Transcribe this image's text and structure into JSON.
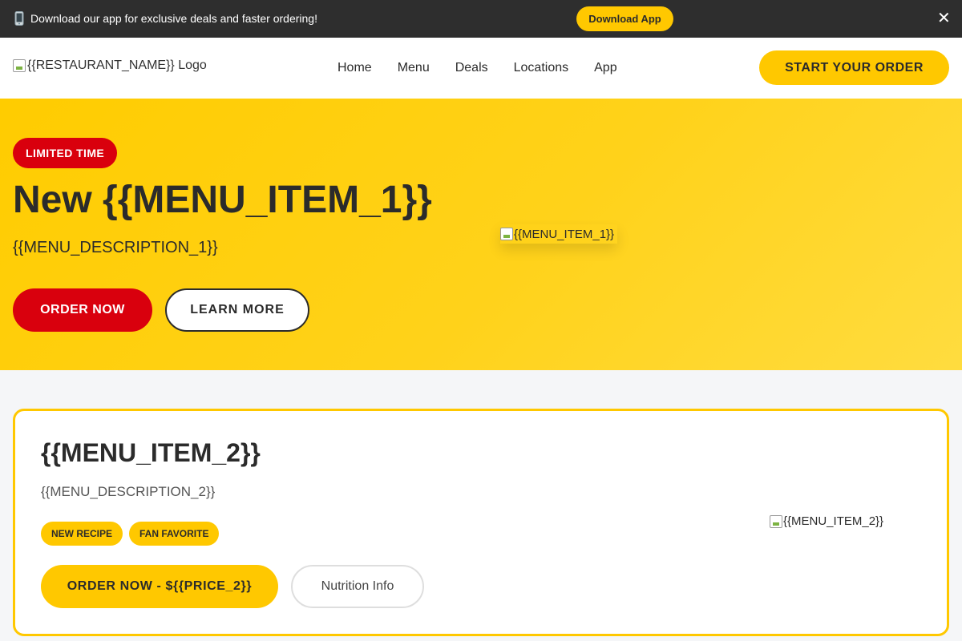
{
  "announcement": {
    "message": "Download our app for exclusive deals and faster ordering!",
    "icon": "mobile-phone-icon",
    "download_label": "Download App",
    "close_glyph": "✕"
  },
  "header": {
    "logo_alt": "{{RESTAURANT_NAME}} Logo",
    "nav": [
      "Home",
      "Menu",
      "Deals",
      "Locations",
      "App"
    ],
    "cta_label": "START YOUR ORDER"
  },
  "hero": {
    "badge": "LIMITED TIME",
    "title": "New {{MENU_ITEM_1}}",
    "description": "{{MENU_DESCRIPTION_1}}",
    "order_label": "ORDER NOW",
    "learn_label": "LEARN MORE",
    "image_alt": "{{MENU_ITEM_1}}"
  },
  "featured": {
    "title": "{{MENU_ITEM_2}}",
    "description": "{{MENU_DESCRIPTION_2}}",
    "tags": [
      "NEW RECIPE",
      "FAN FAVORITE"
    ],
    "order_label": "ORDER NOW - ${{PRICE_2}}",
    "nutrition_label": "Nutrition Info",
    "image_alt": "{{MENU_ITEM_2}}"
  },
  "colors": {
    "brand_yellow": "#ffc800",
    "brand_red": "#d9000d",
    "dark": "#2e2e2e"
  }
}
